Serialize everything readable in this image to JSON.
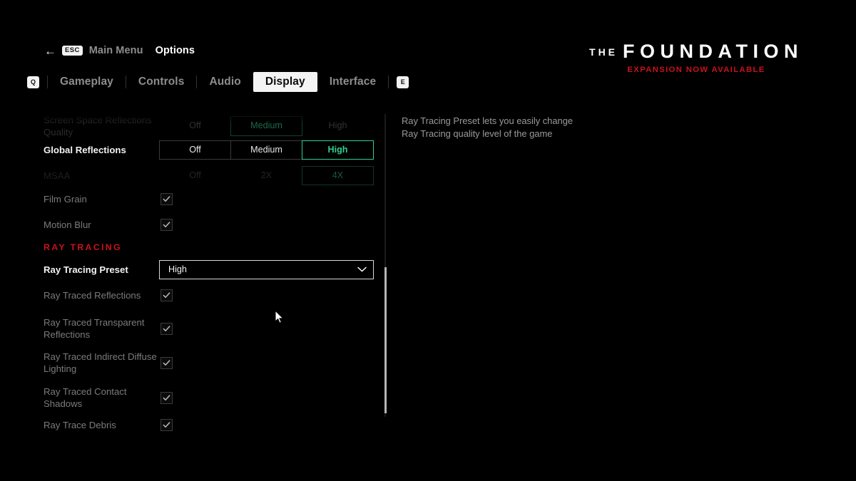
{
  "breadcrumb": {
    "back_arrow": "←",
    "esc_key": "ESC",
    "parent_label": "Main Menu",
    "current_label": "Options"
  },
  "tabbar": {
    "prev_key": "Q",
    "next_key": "E",
    "tabs": [
      {
        "label": "Gameplay",
        "active": false
      },
      {
        "label": "Controls",
        "active": false
      },
      {
        "label": "Audio",
        "active": false
      },
      {
        "label": "Display",
        "active": true
      },
      {
        "label": "Interface",
        "active": false
      }
    ]
  },
  "logo": {
    "the": "THE",
    "title": "FOUNDATION",
    "subtitle": "EXPANSION NOW AVAILABLE"
  },
  "settings": {
    "rows": [
      {
        "id": "screen-space-reflections-quality",
        "label": "Screen Space Reflections Quality",
        "type": "segmented",
        "state": "dim",
        "options": [
          "Off",
          "Medium",
          "High"
        ],
        "selected": "Medium"
      },
      {
        "id": "global-reflections",
        "label": "Global Reflections",
        "type": "segmented",
        "state": "focus",
        "options": [
          "Off",
          "Medium",
          "High"
        ],
        "selected": "High"
      },
      {
        "id": "msaa",
        "label": "MSAA",
        "type": "segmented",
        "state": "dim",
        "options": [
          "Off",
          "2X",
          "4X"
        ],
        "selected": "4X"
      },
      {
        "id": "film-grain",
        "label": "Film Grain",
        "type": "checkbox",
        "state": "normal",
        "checked": true
      },
      {
        "id": "motion-blur",
        "label": "Motion Blur",
        "type": "checkbox",
        "state": "normal",
        "checked": true
      },
      {
        "id": "ray-tracing",
        "label": "RAY TRACING",
        "type": "section"
      },
      {
        "id": "ray-tracing-preset",
        "label": "Ray Tracing Preset",
        "type": "dropdown",
        "state": "focus",
        "value": "High"
      },
      {
        "id": "ray-traced-reflections",
        "label": "Ray Traced Reflections",
        "type": "checkbox",
        "state": "normal",
        "checked": true
      },
      {
        "id": "ray-traced-transparent-reflections",
        "label": "Ray Traced Transparent Reflections",
        "type": "checkbox",
        "state": "normal",
        "checked": true
      },
      {
        "id": "ray-traced-indirect-diffuse-lighting",
        "label": "Ray Traced Indirect Diffuse Lighting",
        "type": "checkbox",
        "state": "normal",
        "checked": true
      },
      {
        "id": "ray-traced-contact-shadows",
        "label": "Ray Traced Contact Shadows",
        "type": "checkbox",
        "state": "normal",
        "checked": true
      },
      {
        "id": "ray-trace-debris",
        "label": "Ray Trace Debris",
        "type": "checkbox",
        "state": "normal",
        "checked": true
      }
    ]
  },
  "help": {
    "line1": "Ray Tracing Preset lets you easily change",
    "line2": "Ray Tracing quality level of the game"
  },
  "colors": {
    "accent_green": "#2ecf8e",
    "accent_red": "#c9121b",
    "text_primary": "#f2f2f2",
    "text_muted": "#7b7b7b",
    "background": "#000000"
  }
}
